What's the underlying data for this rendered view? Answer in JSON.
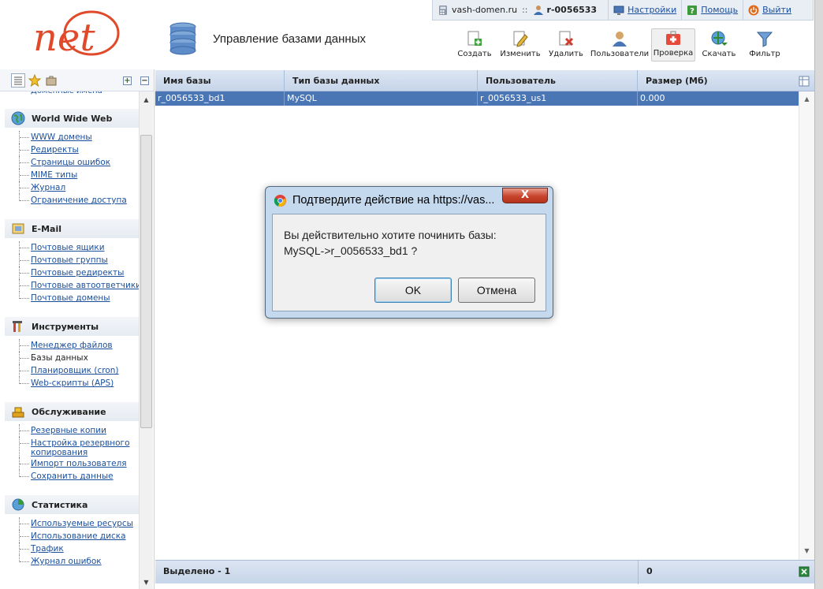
{
  "header": {
    "logo_text": "net",
    "domain": "vash-domen.ru",
    "separator": "::",
    "user": "r-0056533",
    "settings_label": "Настройки",
    "help_label": "Помощь",
    "logout_label": "Выйти",
    "page_title": "Управление базами данных"
  },
  "toolbar": {
    "create": "Создать",
    "edit": "Изменить",
    "delete": "Удалить",
    "users": "Пользователи",
    "check": "Проверка",
    "download": "Скачать",
    "filter": "Фильтр"
  },
  "sidebar": {
    "cut_item": "Доменные имена",
    "groups": [
      {
        "title": "World Wide Web",
        "icon": "globe-icon",
        "items": [
          "WWW домены",
          "Редиректы",
          "Страницы ошибок",
          "MIME типы",
          "Журнал",
          "Ограничение доступа"
        ]
      },
      {
        "title": "E-Mail",
        "icon": "mail-icon",
        "items": [
          "Почтовые ящики",
          "Почтовые группы",
          "Почтовые редиректы",
          "Почтовые автоответчики",
          "Почтовые домены"
        ]
      },
      {
        "title": "Инструменты",
        "icon": "tools-icon",
        "items": [
          "Менеджер файлов",
          "Базы данных",
          "Планировщик (cron)",
          "Web-скрипты (APS)"
        ]
      },
      {
        "title": "Обслуживание",
        "icon": "maintenance-icon",
        "items": [
          "Резервные копии",
          "Настройка резервного копирования",
          "Импорт пользователя",
          "Сохранить данные"
        ]
      },
      {
        "title": "Статистика",
        "icon": "stats-icon",
        "items": [
          "Используемые ресурсы",
          "Использование диска",
          "Трафик",
          "Журнал ошибок"
        ]
      }
    ]
  },
  "table": {
    "columns": [
      "Имя базы",
      "Тип базы данных",
      "Пользователь",
      "Размер (Мб)"
    ],
    "rows": [
      {
        "name": "r_0056533_bd1",
        "type": "MySQL",
        "user": "r_0056533_us1",
        "size": "0.000"
      }
    ],
    "footer_selected": "Выделено - 1",
    "footer_total": "0"
  },
  "dialog": {
    "title": "Подтвердите действие на https://vas...",
    "close_label": "X",
    "message_line1": "Вы действительно хотите починить базы:",
    "message_line2": "MySQL->r_0056533_bd1 ?",
    "ok_label": "OK",
    "cancel_label": "Отмена"
  },
  "colors": {
    "accent": "#4a76b5",
    "logo": "#e04a2a",
    "header_bg": "#c6d5ea",
    "dialog_frame": "#c4d8ee"
  }
}
